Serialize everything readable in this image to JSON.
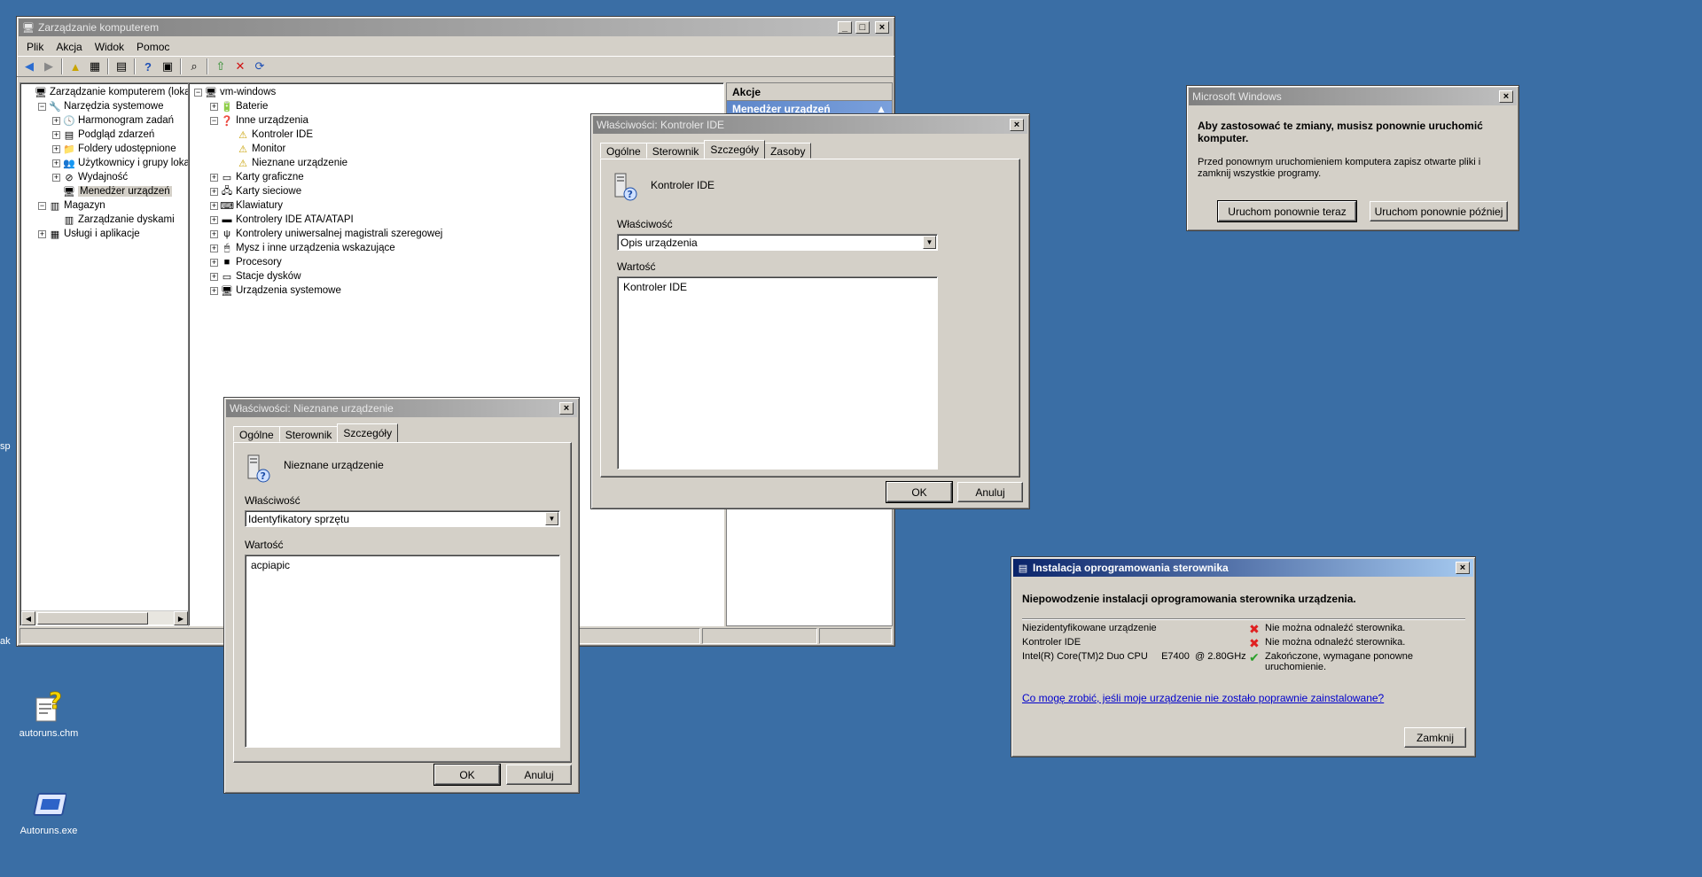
{
  "colors": {
    "desktop": "#3a6ea5",
    "title_active": "#0a246a",
    "window": "#d4d0c8"
  },
  "desktop": {
    "icons": [
      {
        "label": "autoruns.chm",
        "icon": "help-file-icon"
      },
      {
        "label": "Autoruns.exe",
        "icon": "exe-icon"
      }
    ],
    "edge_texts": [
      "sp",
      "ak"
    ]
  },
  "mmc": {
    "title": "Zarządzanie komputerem",
    "menu": [
      "Plik",
      "Akcja",
      "Widok",
      "Pomoc"
    ],
    "tree": [
      {
        "label": "Zarządzanie komputerem (lokalne)",
        "level": 0,
        "exp": ""
      },
      {
        "label": "Narzędzia systemowe",
        "level": 1,
        "exp": "−"
      },
      {
        "label": "Harmonogram zadań",
        "level": 2,
        "exp": "+"
      },
      {
        "label": "Podgląd zdarzeń",
        "level": 2,
        "exp": "+"
      },
      {
        "label": "Foldery udostępnione",
        "level": 2,
        "exp": "+"
      },
      {
        "label": "Użytkownicy i grupy lokaln",
        "level": 2,
        "exp": "+"
      },
      {
        "label": "Wydajność",
        "level": 2,
        "exp": "+"
      },
      {
        "label": "Menedżer urządzeń",
        "level": 2,
        "exp": ""
      },
      {
        "label": "Magazyn",
        "level": 1,
        "exp": "−"
      },
      {
        "label": "Zarządzanie dyskami",
        "level": 2,
        "exp": ""
      },
      {
        "label": "Usługi i aplikacje",
        "level": 1,
        "exp": "+"
      }
    ],
    "devices": [
      {
        "label": "vm-windows",
        "level": 0,
        "exp": "−"
      },
      {
        "label": "Baterie",
        "level": 1,
        "exp": "+"
      },
      {
        "label": "Inne urządzenia",
        "level": 1,
        "exp": "−"
      },
      {
        "label": "Kontroler IDE",
        "level": 2,
        "exp": ""
      },
      {
        "label": "Monitor",
        "level": 2,
        "exp": ""
      },
      {
        "label": "Nieznane urządzenie",
        "level": 2,
        "exp": ""
      },
      {
        "label": "Karty graficzne",
        "level": 1,
        "exp": "+"
      },
      {
        "label": "Karty sieciowe",
        "level": 1,
        "exp": "+"
      },
      {
        "label": "Klawiatury",
        "level": 1,
        "exp": "+"
      },
      {
        "label": "Kontrolery IDE ATA/ATAPI",
        "level": 1,
        "exp": "+"
      },
      {
        "label": "Kontrolery uniwersalnej magistrali szeregowej",
        "level": 1,
        "exp": "+"
      },
      {
        "label": "Mysz i inne urządzenia wskazujące",
        "level": 1,
        "exp": "+"
      },
      {
        "label": "Procesory",
        "level": 1,
        "exp": "+"
      },
      {
        "label": "Stacje dysków",
        "level": 1,
        "exp": "+"
      },
      {
        "label": "Urządzenia systemowe",
        "level": 1,
        "exp": "+"
      }
    ],
    "actions": {
      "header": "Akcje",
      "item": "Menedżer urządzeń"
    }
  },
  "ide_props": {
    "title": "Właściwości: Kontroler IDE",
    "tabs": [
      "Ogólne",
      "Sterownik",
      "Szczegóły",
      "Zasoby"
    ],
    "device_name": "Kontroler IDE",
    "property_label": "Właściwość",
    "property_value": "Opis urządzenia",
    "value_label": "Wartość",
    "value": "Kontroler IDE",
    "ok": "OK",
    "cancel": "Anuluj"
  },
  "unknown_props": {
    "title": "Właściwości: Nieznane urządzenie",
    "tabs": [
      "Ogólne",
      "Sterownik",
      "Szczegóły"
    ],
    "device_name": "Nieznane urządzenie",
    "property_label": "Właściwość",
    "property_value": "Identyfikatory sprzętu",
    "value_label": "Wartość",
    "value": "acpiapic",
    "ok": "OK",
    "cancel": "Anuluj"
  },
  "restart": {
    "title": "Microsoft Windows",
    "heading": "Aby zastosować te zmiany, musisz ponownie uruchomić komputer.",
    "body": "Przed ponownym uruchomieniem komputera zapisz otwarte pliki i zamknij wszystkie programy.",
    "restart_now": "Uruchom ponownie teraz",
    "restart_later": "Uruchom ponownie później"
  },
  "driver": {
    "title": "Instalacja oprogramowania sterownika",
    "heading": "Niepowodzenie instalacji oprogramowania sterownika urządzenia.",
    "rows": [
      {
        "device": "Niezidentyfikowane urządzenie",
        "status_icon": "error-x-icon",
        "status": "Nie można odnaleźć sterownika."
      },
      {
        "device": "Kontroler IDE",
        "status_icon": "error-x-icon",
        "status": "Nie można odnaleźć sterownika."
      },
      {
        "device": "Intel(R) Core(TM)2 Duo CPU     E7400  @ 2.80GHz",
        "status_icon": "check-icon",
        "status": "Zakończone, wymagane ponowne uruchomienie."
      }
    ],
    "help_link": "Co mogę zrobić, jeśli moje urządzenie nie zostało poprawnie zainstalowane?",
    "close": "Zamknij"
  }
}
